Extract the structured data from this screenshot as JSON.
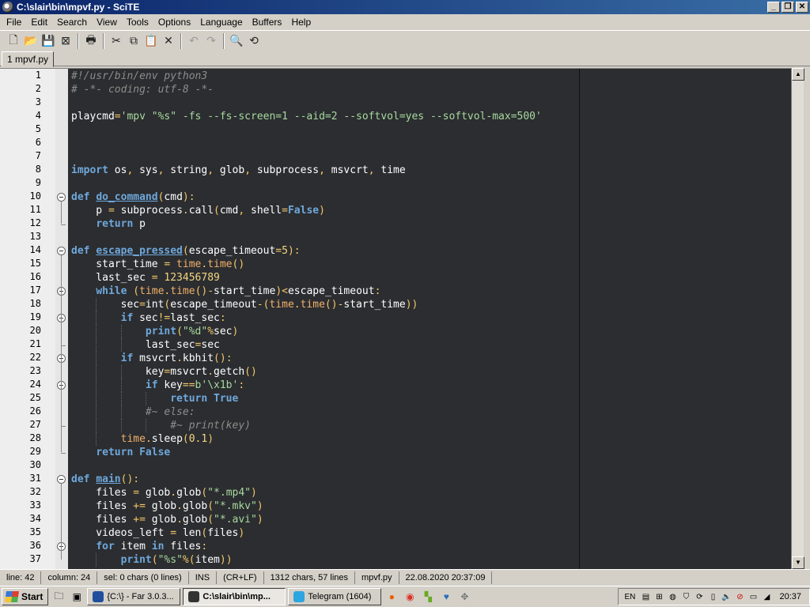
{
  "window": {
    "title": "C:\\slair\\bin\\mpvf.py - SciTE",
    "controls": [
      "_",
      "❐",
      "✕"
    ]
  },
  "menu": [
    "File",
    "Edit",
    "Search",
    "View",
    "Tools",
    "Options",
    "Language",
    "Buffers",
    "Help"
  ],
  "toolbar": [
    {
      "name": "new-icon",
      "glyph": "🗋"
    },
    {
      "name": "open-icon",
      "glyph": "📂"
    },
    {
      "name": "save-icon",
      "glyph": "💾"
    },
    {
      "name": "close-file-icon",
      "glyph": "⊠"
    },
    {
      "sep": true
    },
    {
      "name": "print-icon",
      "glyph": "🖶"
    },
    {
      "sep": true
    },
    {
      "name": "cut-icon",
      "glyph": "✂"
    },
    {
      "name": "copy-icon",
      "glyph": "⧉"
    },
    {
      "name": "paste-icon",
      "glyph": "📋"
    },
    {
      "name": "delete-icon",
      "glyph": "✕"
    },
    {
      "sep": true
    },
    {
      "name": "undo-icon",
      "glyph": "↶"
    },
    {
      "name": "redo-icon",
      "glyph": "↷"
    },
    {
      "sep": true
    },
    {
      "name": "find-icon",
      "glyph": "🔍"
    },
    {
      "name": "replace-icon",
      "glyph": "⟲"
    }
  ],
  "tab": {
    "label": "1 mpvf.py"
  },
  "editor": {
    "lines": [
      [
        [
          "cmt",
          "#!/usr/bin/env python3"
        ]
      ],
      [
        [
          "cmt",
          "# -*- coding: utf-8 -*-"
        ]
      ],
      [],
      [
        [
          "cur",
          "playcmd"
        ],
        [
          "op",
          "="
        ],
        [
          "str",
          "'mpv \"%s\" -fs --fs-screen=1 --aid=2 --softvol=yes --softvol-max=500'"
        ]
      ],
      [],
      [],
      [],
      [
        [
          "kw",
          "import"
        ],
        [
          "cur",
          " os"
        ],
        [
          "op",
          ","
        ],
        [
          "cur",
          " sys"
        ],
        [
          "op",
          ","
        ],
        [
          "cur",
          " string"
        ],
        [
          "op",
          ","
        ],
        [
          "cur",
          " glob"
        ],
        [
          "op",
          ","
        ],
        [
          "cur",
          " subprocess"
        ],
        [
          "op",
          ","
        ],
        [
          "cur",
          " msvcrt"
        ],
        [
          "op",
          ","
        ],
        [
          "cur",
          " time"
        ]
      ],
      [],
      [
        [
          "kw",
          "def "
        ],
        [
          "fn",
          "do_command"
        ],
        [
          "op",
          "("
        ],
        [
          "cur",
          "cmd"
        ],
        [
          "op",
          "):"
        ]
      ],
      [
        [
          "cur",
          "    p "
        ],
        [
          "op",
          "="
        ],
        [
          "cur",
          " subprocess"
        ],
        [
          "op",
          "."
        ],
        [
          "cur",
          "call"
        ],
        [
          "op",
          "("
        ],
        [
          "cur",
          "cmd"
        ],
        [
          "op",
          ","
        ],
        [
          "cur",
          " shell"
        ],
        [
          "op",
          "="
        ],
        [
          "kw",
          "False"
        ],
        [
          "op",
          ")"
        ]
      ],
      [
        [
          "cur",
          "    "
        ],
        [
          "kw",
          "return"
        ],
        [
          "cur",
          " p"
        ]
      ],
      [],
      [
        [
          "kw",
          "def "
        ],
        [
          "fn",
          "escape_pressed"
        ],
        [
          "op",
          "("
        ],
        [
          "cur",
          "escape_timeout"
        ],
        [
          "op",
          "="
        ],
        [
          "num",
          "5"
        ],
        [
          "op",
          "):"
        ]
      ],
      [
        [
          "cur",
          "    start_time "
        ],
        [
          "op",
          "="
        ],
        [
          "bi",
          " time"
        ],
        [
          "op",
          "."
        ],
        [
          "bi",
          "time"
        ],
        [
          "op",
          "()"
        ]
      ],
      [
        [
          "cur",
          "    last_sec "
        ],
        [
          "op",
          "="
        ],
        [
          "num",
          " 123456789"
        ]
      ],
      [
        [
          "cur",
          "    "
        ],
        [
          "kw",
          "while"
        ],
        [
          "op",
          " ("
        ],
        [
          "bi",
          "time"
        ],
        [
          "op",
          "."
        ],
        [
          "bi",
          "time"
        ],
        [
          "op",
          "()-"
        ],
        [
          "cur",
          "start_time"
        ],
        [
          "op",
          ")<"
        ],
        [
          "cur",
          "escape_timeout"
        ],
        [
          "op",
          ":"
        ]
      ],
      [
        [
          "cur",
          "        sec"
        ],
        [
          "op",
          "="
        ],
        [
          "cur",
          "int"
        ],
        [
          "op",
          "("
        ],
        [
          "cur",
          "escape_timeout"
        ],
        [
          "op",
          "-("
        ],
        [
          "bi",
          "time"
        ],
        [
          "op",
          "."
        ],
        [
          "bi",
          "time"
        ],
        [
          "op",
          "()-"
        ],
        [
          "cur",
          "start_time"
        ],
        [
          "op",
          "))"
        ]
      ],
      [
        [
          "cur",
          "        "
        ],
        [
          "kw",
          "if"
        ],
        [
          "cur",
          " sec"
        ],
        [
          "op",
          "!="
        ],
        [
          "cur",
          "last_sec"
        ],
        [
          "op",
          ":"
        ]
      ],
      [
        [
          "cur",
          "            "
        ],
        [
          "kw",
          "print"
        ],
        [
          "op",
          "("
        ],
        [
          "str",
          "\"%d\""
        ],
        [
          "op",
          "%"
        ],
        [
          "cur",
          "sec"
        ],
        [
          "op",
          ")"
        ]
      ],
      [
        [
          "cur",
          "            last_sec"
        ],
        [
          "op",
          "="
        ],
        [
          "cur",
          "sec"
        ]
      ],
      [
        [
          "cur",
          "        "
        ],
        [
          "kw",
          "if"
        ],
        [
          "cur",
          " msvcrt"
        ],
        [
          "op",
          "."
        ],
        [
          "cur",
          "kbhit"
        ],
        [
          "op",
          "():"
        ]
      ],
      [
        [
          "cur",
          "            key"
        ],
        [
          "op",
          "="
        ],
        [
          "cur",
          "msvcrt"
        ],
        [
          "op",
          "."
        ],
        [
          "cur",
          "getch"
        ],
        [
          "op",
          "()"
        ]
      ],
      [
        [
          "cur",
          "            "
        ],
        [
          "kw",
          "if"
        ],
        [
          "cur",
          " key"
        ],
        [
          "op",
          "=="
        ],
        [
          "str",
          "b'\\x1b'"
        ],
        [
          "op",
          ":"
        ]
      ],
      [
        [
          "cur",
          "                "
        ],
        [
          "kw",
          "return True"
        ]
      ],
      [
        [
          "cur",
          "            "
        ],
        [
          "cmt",
          "#~ else:"
        ]
      ],
      [
        [
          "cur",
          "                "
        ],
        [
          "cmt",
          "#~ print(key)"
        ]
      ],
      [
        [
          "cur",
          "        "
        ],
        [
          "bi",
          "time"
        ],
        [
          "op",
          "."
        ],
        [
          "cur",
          "sleep"
        ],
        [
          "op",
          "("
        ],
        [
          "num",
          "0.1"
        ],
        [
          "op",
          ")"
        ]
      ],
      [
        [
          "cur",
          "    "
        ],
        [
          "kw",
          "return False"
        ]
      ],
      [],
      [
        [
          "kw",
          "def "
        ],
        [
          "fn",
          "main"
        ],
        [
          "op",
          "():"
        ]
      ],
      [
        [
          "cur",
          "    files "
        ],
        [
          "op",
          "="
        ],
        [
          "cur",
          " glob"
        ],
        [
          "op",
          "."
        ],
        [
          "cur",
          "glob"
        ],
        [
          "op",
          "("
        ],
        [
          "str",
          "\"*.mp4\""
        ],
        [
          "op",
          ")"
        ]
      ],
      [
        [
          "cur",
          "    files "
        ],
        [
          "op",
          "+="
        ],
        [
          "cur",
          " glob"
        ],
        [
          "op",
          "."
        ],
        [
          "cur",
          "glob"
        ],
        [
          "op",
          "("
        ],
        [
          "str",
          "\"*.mkv\""
        ],
        [
          "op",
          ")"
        ]
      ],
      [
        [
          "cur",
          "    files "
        ],
        [
          "op",
          "+="
        ],
        [
          "cur",
          " glob"
        ],
        [
          "op",
          "."
        ],
        [
          "cur",
          "glob"
        ],
        [
          "op",
          "("
        ],
        [
          "str",
          "\"*.avi\""
        ],
        [
          "op",
          ")"
        ]
      ],
      [
        [
          "cur",
          "    videos_left "
        ],
        [
          "op",
          "="
        ],
        [
          "cur",
          " len"
        ],
        [
          "op",
          "("
        ],
        [
          "cur",
          "files"
        ],
        [
          "op",
          ")"
        ]
      ],
      [
        [
          "cur",
          "    "
        ],
        [
          "kw",
          "for"
        ],
        [
          "cur",
          " item "
        ],
        [
          "kw",
          "in"
        ],
        [
          "cur",
          " files"
        ],
        [
          "op",
          ":"
        ]
      ],
      [
        [
          "cur",
          "        "
        ],
        [
          "kw",
          "print"
        ],
        [
          "op",
          "("
        ],
        [
          "str",
          "\"%s\""
        ],
        [
          "op",
          "%"
        ],
        [
          "op",
          "("
        ],
        [
          "cur",
          "item"
        ],
        [
          "op",
          "))"
        ]
      ]
    ]
  },
  "statusbar": {
    "line": "line: 42",
    "column": "column: 24",
    "sel": "sel: 0 chars  (0 lines)",
    "mode": "INS",
    "eol": "(CR+LF)",
    "stats": "1312 chars, 57 lines",
    "file": "mpvf.py",
    "datetime": "22.08.2020 20:37:09"
  },
  "taskbar": {
    "start": "Start",
    "tasks": [
      {
        "label": "{C:\\} - Far 3.0.3...",
        "active": false,
        "color": "#1f4f9c"
      },
      {
        "label": "C:\\slair\\bin\\mp...",
        "active": true,
        "color": "#333"
      },
      {
        "label": "Telegram (1604)",
        "active": false,
        "color": "#2ca5e0"
      }
    ],
    "lang": "EN",
    "clock": "20:37"
  }
}
